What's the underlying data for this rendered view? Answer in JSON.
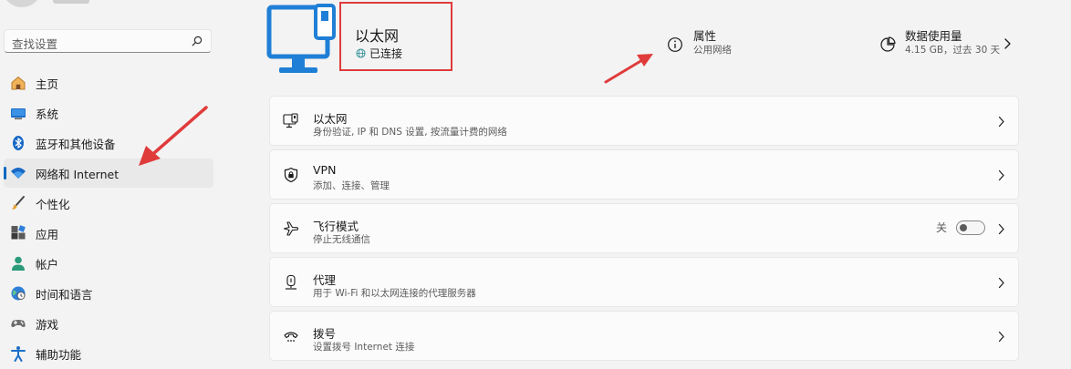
{
  "sidebar": {
    "search_placeholder": "查找设置",
    "items": [
      {
        "label": "主页",
        "icon": "home-icon"
      },
      {
        "label": "系统",
        "icon": "system-icon"
      },
      {
        "label": "蓝牙和其他设备",
        "icon": "bluetooth-icon"
      },
      {
        "label": "网络和 Internet",
        "icon": "wifi-icon",
        "selected": true
      },
      {
        "label": "个性化",
        "icon": "brush-icon"
      },
      {
        "label": "应用",
        "icon": "apps-icon"
      },
      {
        "label": "帐户",
        "icon": "account-icon"
      },
      {
        "label": "时间和语言",
        "icon": "globe-clock-icon"
      },
      {
        "label": "游戏",
        "icon": "gamepad-icon"
      },
      {
        "label": "辅助功能",
        "icon": "accessibility-icon"
      }
    ]
  },
  "header": {
    "title": "以太网",
    "status": "已连接",
    "properties": {
      "title": "属性",
      "subtitle": "公用网络"
    },
    "data_usage": {
      "title": "数据使用量",
      "subtitle": "4.15 GB，过去 30 天"
    }
  },
  "cards": [
    {
      "title": "以太网",
      "subtitle": "身份验证, IP 和 DNS 设置, 按流量计费的网络",
      "icon": "ethernet-icon"
    },
    {
      "title": "VPN",
      "subtitle": "添加、连接、管理",
      "icon": "vpn-shield-icon"
    },
    {
      "title": "飞行模式",
      "subtitle": "停止无线通信",
      "icon": "airplane-icon",
      "toggle_label": "关",
      "toggle_on": false
    },
    {
      "title": "代理",
      "subtitle": "用于 Wi-Fi 和以太网连接的代理服务器",
      "icon": "proxy-icon"
    },
    {
      "title": "拨号",
      "subtitle": "设置拨号 Internet 连接",
      "icon": "dialup-icon"
    }
  ],
  "colors": {
    "accent": "#0067c0",
    "annotation_red": "#e03b3b",
    "background": "#f3f3f3",
    "card": "#fbfbfb"
  }
}
